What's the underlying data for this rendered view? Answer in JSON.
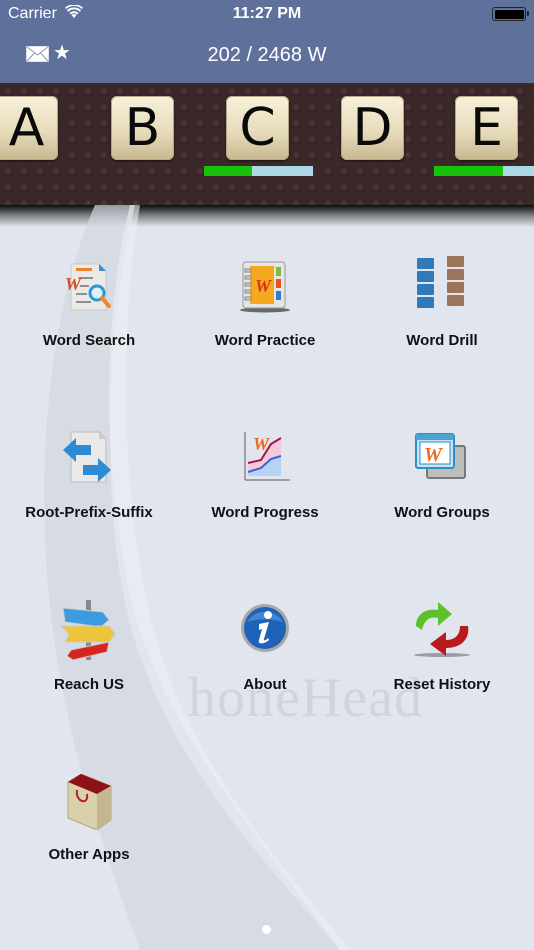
{
  "status_bar": {
    "carrier": "Carrier",
    "time": "11:27 PM",
    "wifi_icon": "wifi-icon",
    "battery_icon": "battery-icon"
  },
  "nav_bar": {
    "mail_icon": "mail-icon",
    "star_icon": "star-icon",
    "word_count": "202 / 2468 W"
  },
  "letters": [
    {
      "letter": "A",
      "progress": null
    },
    {
      "letter": "B",
      "progress": null
    },
    {
      "letter": "C",
      "progress": 0.44
    },
    {
      "letter": "D",
      "progress": null
    },
    {
      "letter": "E",
      "progress": 0.63
    }
  ],
  "colors": {
    "nav": "#5f719a",
    "progress_fill": "#17c20a",
    "progress_track": "#add8e6",
    "background": "#e1e5ee"
  },
  "menu": [
    {
      "label": "Word Search",
      "icon": "word-search-icon"
    },
    {
      "label": "Word Practice",
      "icon": "word-practice-icon"
    },
    {
      "label": "Word Drill",
      "icon": "word-drill-icon"
    },
    {
      "label": "Root-Prefix-Suffix",
      "icon": "root-prefix-suffix-icon"
    },
    {
      "label": "Word Progress",
      "icon": "word-progress-icon"
    },
    {
      "label": "Word Groups",
      "icon": "word-groups-icon"
    },
    {
      "label": "Reach US",
      "icon": "signpost-icon"
    },
    {
      "label": "About",
      "icon": "info-icon"
    },
    {
      "label": "Reset History",
      "icon": "reset-arrows-icon"
    },
    {
      "label": "Other Apps",
      "icon": "shopping-bag-icon"
    }
  ],
  "watermark": "honeHead",
  "pager": {
    "pages": 1,
    "current": 1
  }
}
